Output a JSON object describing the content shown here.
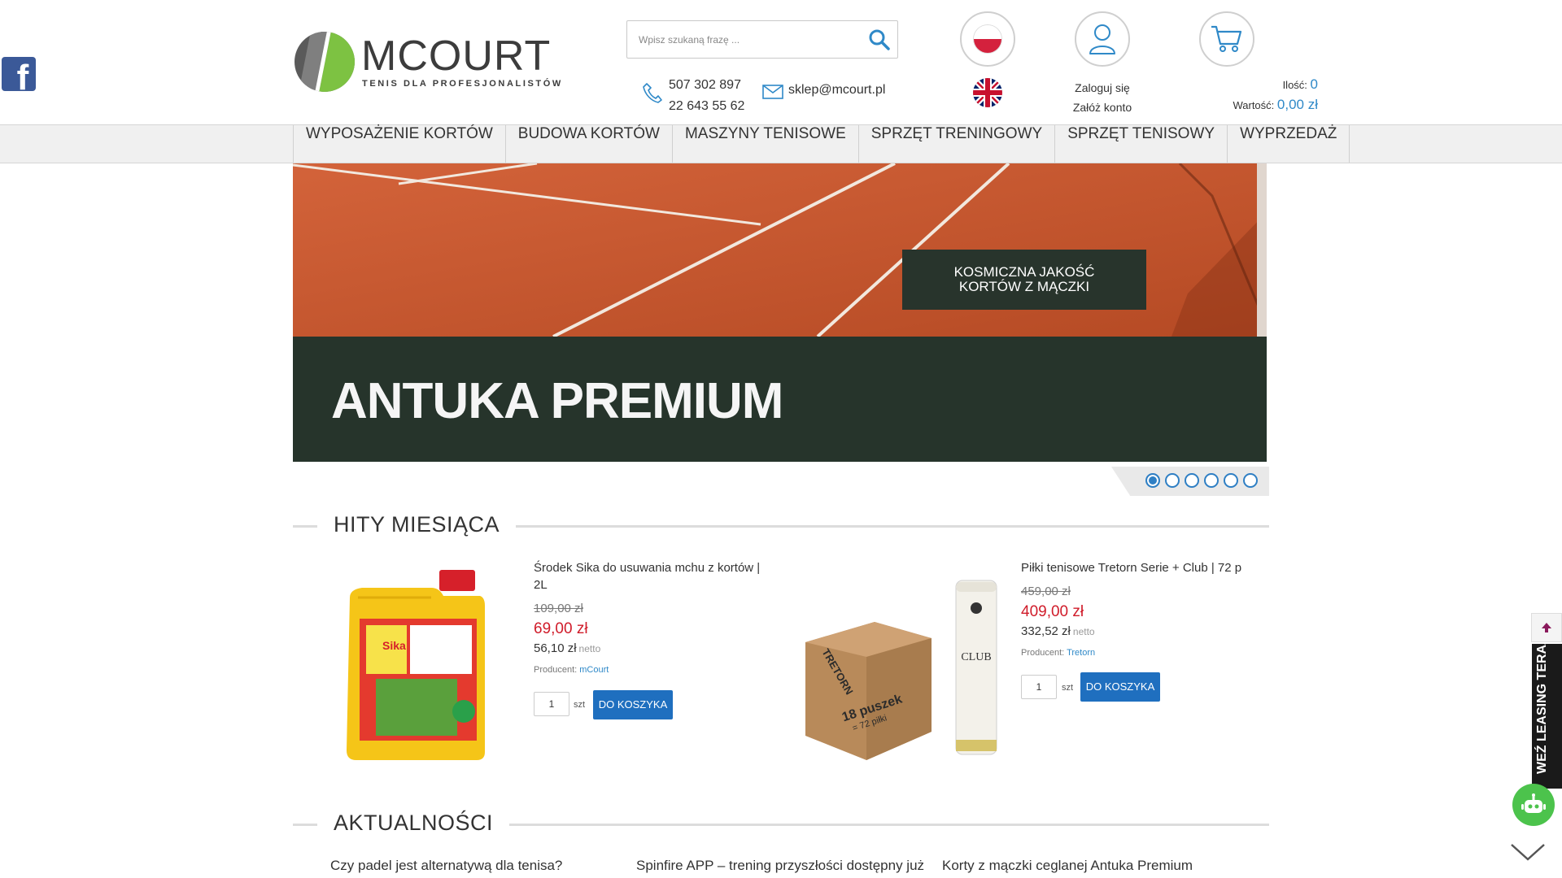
{
  "header": {
    "logo_word": "MCOURT",
    "logo_tagline": "TENIS DLA PROFESJONALISTÓW",
    "search_placeholder": "Wpisz szukaną frazę ...",
    "phone_1": "507 302 897",
    "phone_2": "22 643 55 62",
    "email": "sklep@mcourt.pl",
    "login_label": "Zaloguj się",
    "register_label": "Załóż konto",
    "cart_qty_label": "Ilość:",
    "cart_qty_value": "0",
    "cart_value_label": "Wartość:",
    "cart_value": "0,00 zł"
  },
  "nav": {
    "items": [
      "WYPOSAŻENIE KORTÓW",
      "BUDOWA KORTÓW",
      "MASZYNY TENISOWE",
      "SPRZĘT TRENINGOWY",
      "SPRZĘT TENISOWY",
      "WYPRZEDAŻ"
    ]
  },
  "slider": {
    "tag_line_1": "KOSMICZNA JAKOŚĆ",
    "tag_line_2": "KORTÓW Z MĄCZKI",
    "title": "ANTUKA PREMIUM",
    "slide_count": 6,
    "active_index": 0
  },
  "hits": {
    "title": "HITY MIESIĄCA",
    "products": [
      {
        "name_line_1": "Środek Sika do usuwania mchu z kortów |",
        "name_line_2": "2L",
        "old_price": "109,00 zł",
        "price": "69,00 zł",
        "net_price": "56,10 zł",
        "net_label": "netto",
        "producer_label": "Producent:",
        "producer": "mCourt",
        "qty": "1",
        "unit": "szt",
        "button": "DO KOSZYKA",
        "image_label": "Sika"
      },
      {
        "name_line_1": "Piłki tenisowe Tretorn Serie + Club | 72 p",
        "old_price": "459,00 zł",
        "price": "409,00 zł",
        "net_price": "332,52 zł",
        "net_label": "netto",
        "producer_label": "Producent:",
        "producer": "Tretorn",
        "qty": "1",
        "unit": "szt",
        "button": "DO KOSZYKA",
        "box_text_1": "18 puszek",
        "box_text_2": "= 72 piłki",
        "box_brand": "TRETORN",
        "can_text": "CLUB"
      }
    ]
  },
  "news": {
    "title": "AKTUALNOŚCI",
    "items": [
      "Czy padel jest alternatywą dla tenisa?",
      "Spinfire APP – trening przyszłości dostępny już",
      "Korty z mączki ceglanej Antuka Premium"
    ]
  },
  "widgets": {
    "leasing": "WEŹ LEASING TERAZ"
  },
  "colors": {
    "accent_blue": "#2f89c8",
    "button_blue": "#1f6fbf",
    "price_red": "#d01c2a",
    "court_clay": "#c9582e",
    "slide_dark": "#26342b",
    "logo_green": "#7dc242"
  }
}
